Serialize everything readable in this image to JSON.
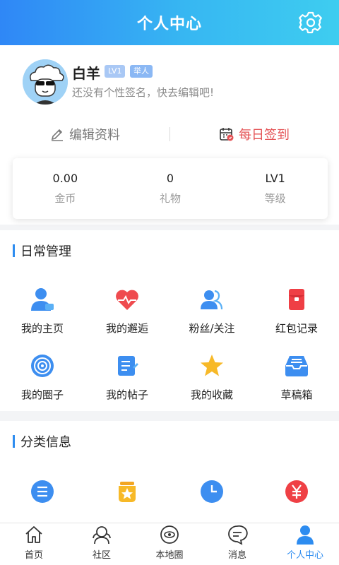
{
  "header": {
    "title": "个人中心"
  },
  "profile": {
    "username": "白羊",
    "badge_level": "LV1",
    "badge_role": "举人",
    "signature": "还没有个性签名，快去编辑吧!",
    "edit_label": "编辑资料",
    "sign_label": "每日签到"
  },
  "stats": [
    {
      "value": "0.00",
      "label": "金币"
    },
    {
      "value": "0",
      "label": "礼物"
    },
    {
      "value": "LV1",
      "label": "等级"
    }
  ],
  "daily": {
    "title": "日常管理",
    "items": [
      {
        "label": "我的主页",
        "icon": "user-home-icon"
      },
      {
        "label": "我的邂逅",
        "icon": "heart-pulse-icon"
      },
      {
        "label": "粉丝/关注",
        "icon": "users-icon"
      },
      {
        "label": "红包记录",
        "icon": "red-envelope-icon"
      },
      {
        "label": "我的圈子",
        "icon": "target-icon"
      },
      {
        "label": "我的帖子",
        "icon": "post-icon"
      },
      {
        "label": "我的收藏",
        "icon": "star-icon"
      },
      {
        "label": "草稿箱",
        "icon": "inbox-icon"
      }
    ]
  },
  "category": {
    "title": "分类信息",
    "items": [
      {
        "icon": "list-icon"
      },
      {
        "icon": "star-jar-icon"
      },
      {
        "icon": "clock-icon"
      },
      {
        "icon": "yuan-icon"
      }
    ]
  },
  "tabs": [
    {
      "label": "首页",
      "icon": "home-icon"
    },
    {
      "label": "社区",
      "icon": "community-icon"
    },
    {
      "label": "本地圈",
      "icon": "local-circle-icon"
    },
    {
      "label": "消息",
      "icon": "message-icon"
    },
    {
      "label": "个人中心",
      "icon": "profile-icon"
    }
  ],
  "colors": {
    "accent": "#2d8cf0",
    "sign": "#e45154",
    "header_start": "#2f87f6",
    "header_end": "#3ecdf0"
  }
}
